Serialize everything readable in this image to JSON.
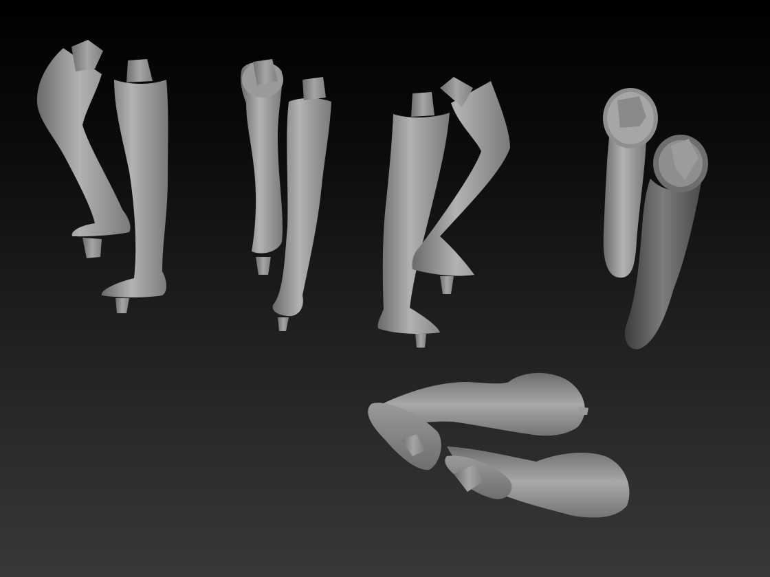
{
  "scene": {
    "background_top": "#000000",
    "background_bottom": "#383838",
    "material_light": "#b4b4b4",
    "material_mid": "#8e8e8e",
    "material_dark": "#5a5a5a"
  }
}
